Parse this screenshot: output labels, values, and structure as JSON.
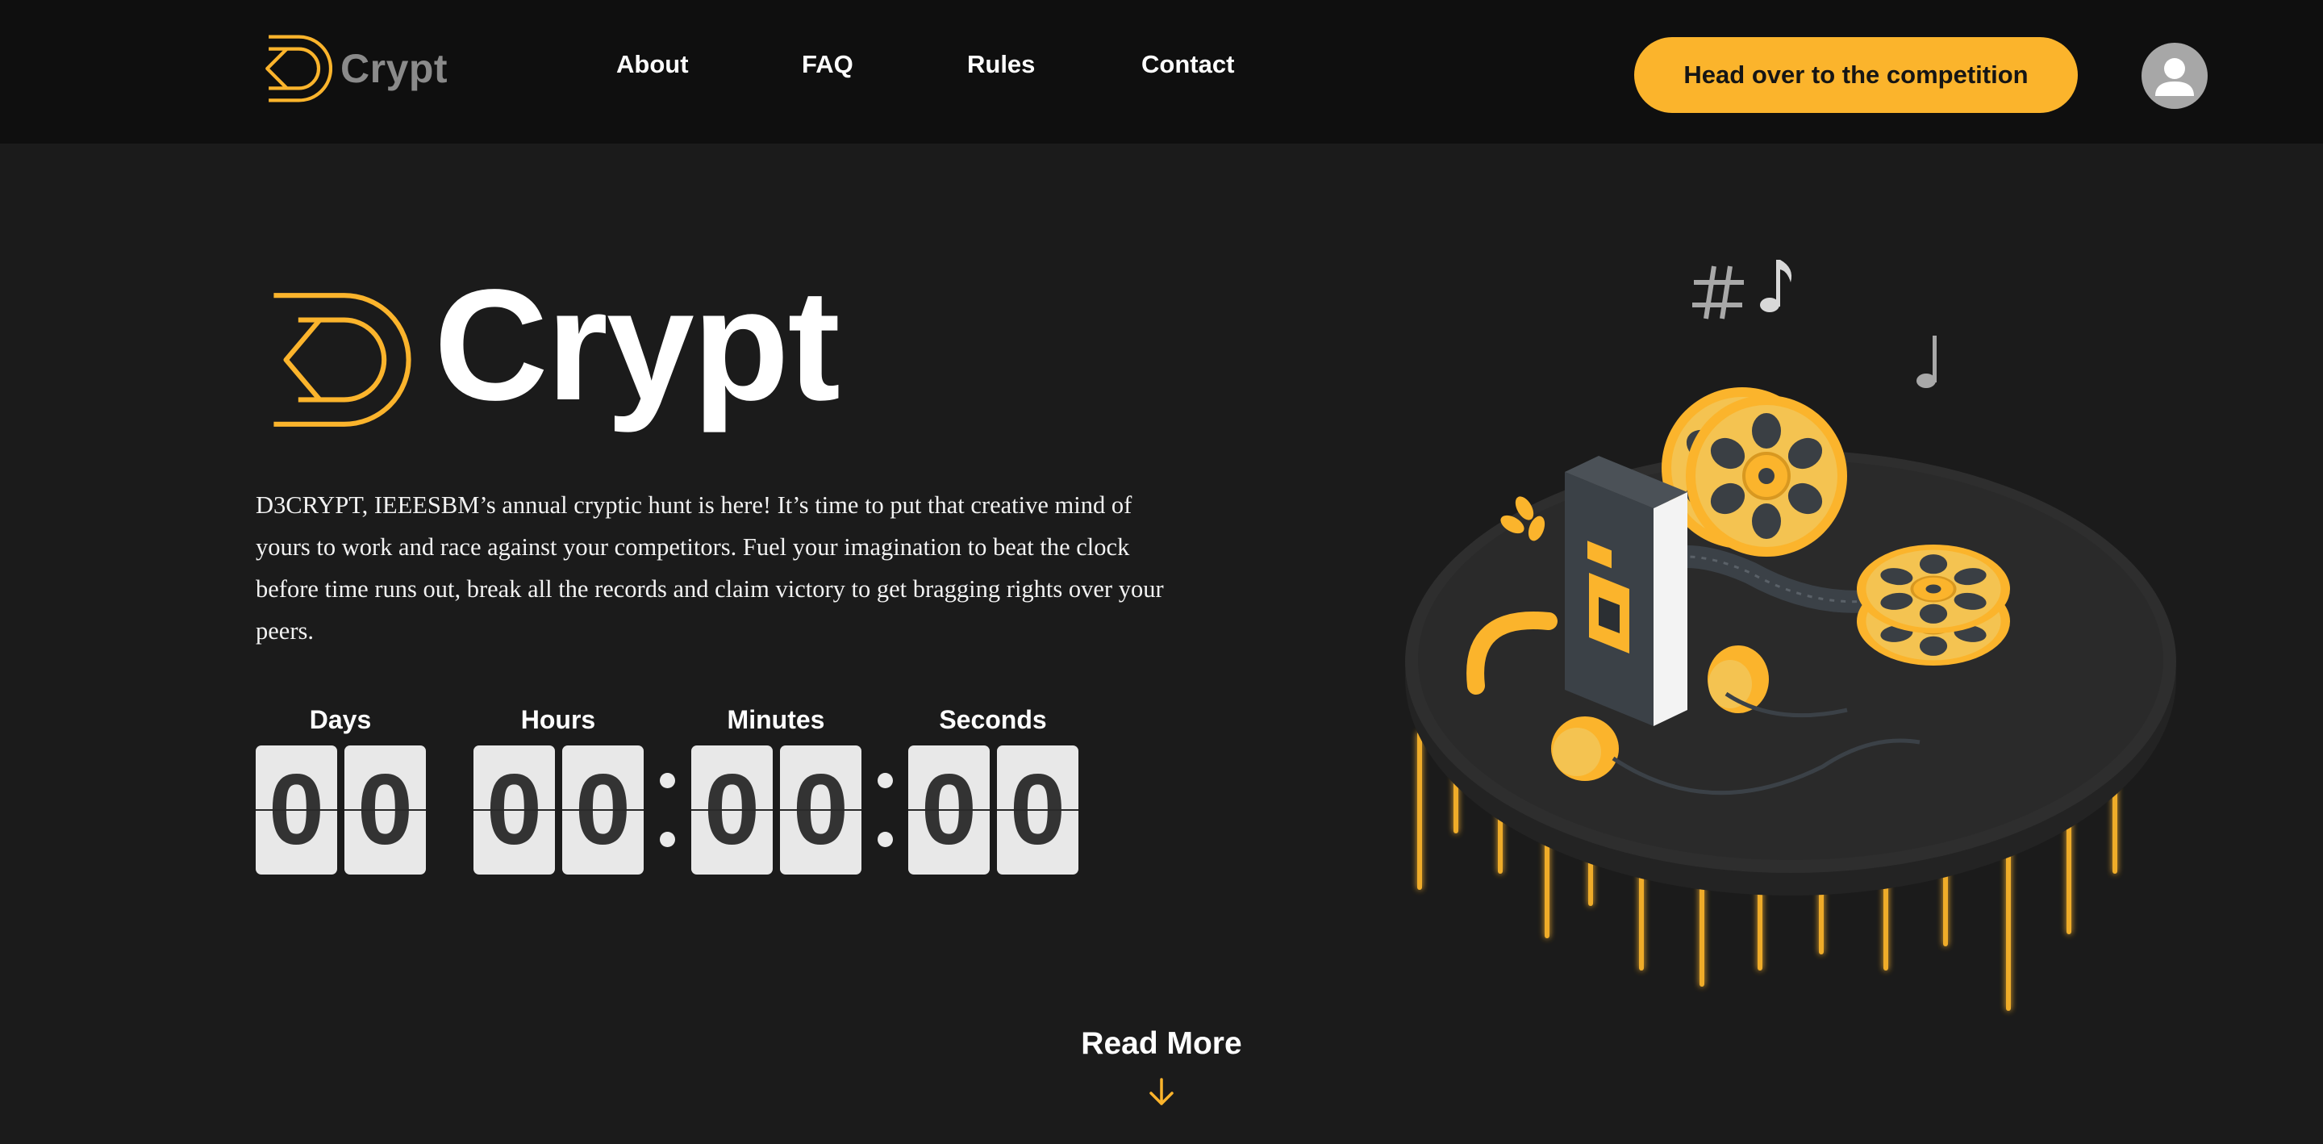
{
  "nav": {
    "logo_text": "Crypt",
    "links": [
      "About",
      "FAQ",
      "Rules",
      "Contact"
    ],
    "cta_label": "Head over to the competition"
  },
  "hero": {
    "logo_text": "Crypt",
    "description": "D3CRYPT, IEEESBM’s annual cryptic hunt is here! It’s time to put that creative mind of yours to work and race against your competitors. Fuel your imagination to beat the clock before time runs out, break all the records and claim victory to get bragging rights over your peers."
  },
  "countdown": {
    "labels": [
      "Days",
      "Hours",
      "Minutes",
      "Seconds"
    ],
    "days": [
      "0",
      "0"
    ],
    "hours": [
      "0",
      "0"
    ],
    "minutes": [
      "0",
      "0"
    ],
    "seconds": [
      "0",
      "0"
    ]
  },
  "read_more": "Read More",
  "icons": {
    "logo": "d3-logo-icon",
    "avatar": "user-avatar-icon",
    "arrow": "arrow-down-icon"
  },
  "colors": {
    "accent": "#fbb42c",
    "background": "#1b1b1b",
    "navbar": "#0f0f0f",
    "digit_bg": "#e8e8e8"
  }
}
